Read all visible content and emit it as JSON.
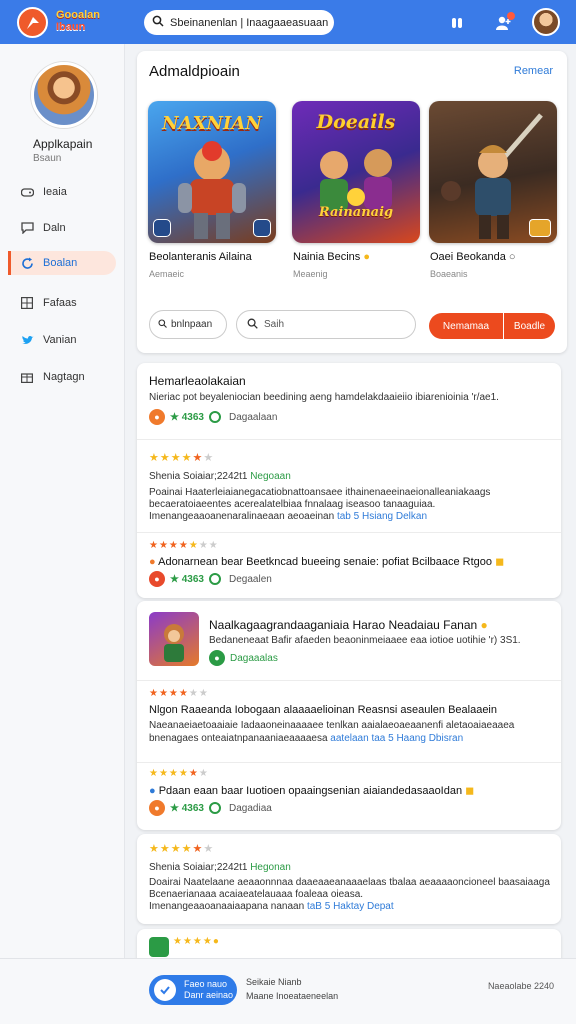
{
  "header": {
    "logo_line1": "Gooalan",
    "logo_line2": "Ibaun",
    "search_value": "Sbeinanenlan | Inaagaaeasuaan"
  },
  "sidebar": {
    "profile_name": "Applkapain",
    "profile_sub": "Bsaun",
    "items": [
      {
        "label": "Ieaia",
        "icon": "gamepad-icon",
        "active": false
      },
      {
        "label": "Daln",
        "icon": "chat-icon",
        "active": false
      },
      {
        "label": "Boalan",
        "icon": "refresh-icon",
        "active": true
      },
      {
        "label": "Fafaas",
        "icon": "grid-icon",
        "active": false
      },
      {
        "label": "Vanian",
        "icon": "twitter-icon",
        "active": false
      },
      {
        "label": "Nagtagn",
        "icon": "gift-icon",
        "active": false
      }
    ]
  },
  "featured": {
    "title": "Admaldpioain",
    "link": "Remear",
    "games": [
      {
        "art_text": "NAXNIAN",
        "title": "Beolanteranis Ailaina",
        "sub": "Aemaeic"
      },
      {
        "art_text": "Doeails",
        "art_text2": "Rainanaig",
        "title": "Nainia Becins",
        "sub": "Meaenig"
      },
      {
        "title": "Oaei Beokanda",
        "sub": "Boaeanis"
      }
    ],
    "filter_label": "bnlnpaan",
    "search_placeholder": "Saih",
    "btn_left": "Nemamaa",
    "btn_right": "Boadle"
  },
  "reviews_card1": {
    "title": "Hemarleaolakaian",
    "desc": "Nieriac pot beyaleniocian beedining aeng hamdelakdaaieiio ibiarenioinia 'r/ae1.",
    "meta_score": "★ 4363",
    "meta_label": "Dagaalaan",
    "rows": [
      {
        "stars": 4.5,
        "meta_line": "Shenia  Soiaiar;2242t1",
        "meta_tag": "Negoaan",
        "text1": "Poainai  Haaterleiaianegacatiobnattoansaee  ithainenaeeinaeionalleaniakaags",
        "text2": "becaeratoiaeentes acerealatelbiaa fnnalaag iseasoo tanaaguiaa.",
        "text3": "Imenangeaaoanenaralinaeaan aeoaeinan",
        "link": "tab 5 Hsiang Delkan"
      },
      {
        "stars": 4.5,
        "text1": "Adonarnean bear Beetkncad bueeing senaie: pofiat Bcilbaace Rtgoo",
        "meta_score": "★ 4363",
        "meta_label": "Degaalen"
      }
    ]
  },
  "reviews_card2": {
    "title": "Naalkagaagrandaaganiaia Harao Neadaiau Fanan",
    "desc": "Bedaneneaat Bafir afaeden beaoninmeiaaee eaa iotioe  uotihie 'r) 3S1.",
    "meta_label": "Dagaaalas",
    "rows": [
      {
        "stars": 4,
        "text1": "Nlgon  Raaeanda Iobogaan alaaaaelioinan Reasnsi aseaulen Bealaaein",
        "text2": "Naeanaeiaetoaaiaie Iadaaoneinaaaaee tenlkan aaialaeoaeaanenfi aletaoaiaeaaea",
        "text3": "bnenagaes onteaiatnpanaaniaeaaaaesa",
        "link": "aatelaan taa 5 Haang Dbisran"
      },
      {
        "stars": 4,
        "text1": "Pdaan eaan baar Iuotioen opaaingsenian aiaiandedasaaoIdan",
        "meta_score": "★ 4363",
        "meta_label": "Dagadiaa"
      }
    ]
  },
  "reviews_card3": {
    "stars": 4,
    "meta_line": "Shenia  Soiaiar;2242t1",
    "meta_tag": "Hegonan",
    "text1": "Doairai  Naatelaane aeaaonnnaa  daaeaaeanaaaelaas tbalaa aeaaaaoncioneel baasaiaaga",
    "text2": "Bcenaerianaaa acaiaeatelauaaa foaleaa oieasa.",
    "text3": "Imenangeaaoanaaiaapana nanaan",
    "link": "taB 5 Haktay Depat"
  },
  "footer": {
    "btn_line1": "Faeo nauo",
    "btn_line2": "Danr aeinao",
    "mid_line1": "Seikaie Nianb",
    "mid_line2": "Maane Inoeataeneelan",
    "right": "Naeaolabe 2240"
  }
}
